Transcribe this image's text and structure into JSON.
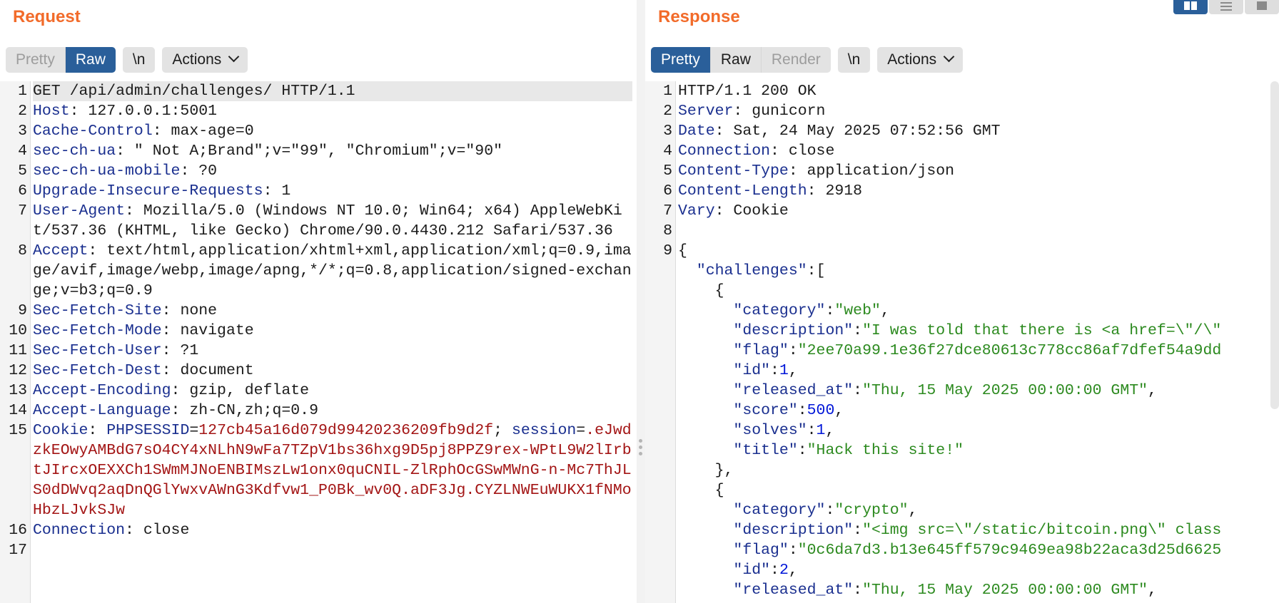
{
  "request": {
    "title": "Request",
    "tabs": [
      {
        "label": "Pretty",
        "state": "disabled"
      },
      {
        "label": "Raw",
        "state": "active"
      }
    ],
    "newline_label": "\\n",
    "actions_label": "Actions",
    "lines": [
      {
        "n": "1",
        "hl": true,
        "segs": [
          {
            "t": "GET /api/admin/challenges/ HTTP/1.1"
          }
        ]
      },
      {
        "n": "2",
        "segs": [
          {
            "c": "k",
            "t": "Host"
          },
          {
            "t": ": 127.0.0.1:5001"
          }
        ]
      },
      {
        "n": "3",
        "segs": [
          {
            "c": "k",
            "t": "Cache-Control"
          },
          {
            "t": ": max-age=0"
          }
        ]
      },
      {
        "n": "4",
        "segs": [
          {
            "c": "k",
            "t": "sec-ch-ua"
          },
          {
            "t": ": \" Not A;Brand\";v=\"99\", \"Chromium\";v=\"90\""
          }
        ]
      },
      {
        "n": "5",
        "segs": [
          {
            "c": "k",
            "t": "sec-ch-ua-mobile"
          },
          {
            "t": ": ?0"
          }
        ]
      },
      {
        "n": "6",
        "segs": [
          {
            "c": "k",
            "t": "Upgrade-Insecure-Requests"
          },
          {
            "t": ": 1"
          }
        ]
      },
      {
        "n": "7",
        "segs": [
          {
            "c": "k",
            "t": "User-Agent"
          },
          {
            "t": ": Mozilla/5.0 (Windows NT 10.0; Win64; x64) AppleWebKit/537.36 (KHTML, like Gecko) Chrome/90.0.4430.212 Safari/537.36"
          }
        ]
      },
      {
        "n": "8",
        "segs": [
          {
            "c": "k",
            "t": "Accept"
          },
          {
            "t": ": text/html,application/xhtml+xml,application/xml;q=0.9,image/avif,image/webp,image/apng,*/*;q=0.8,application/signed-exchange;v=b3;q=0.9"
          }
        ]
      },
      {
        "n": "9",
        "segs": [
          {
            "c": "k",
            "t": "Sec-Fetch-Site"
          },
          {
            "t": ": none"
          }
        ]
      },
      {
        "n": "10",
        "segs": [
          {
            "c": "k",
            "t": "Sec-Fetch-Mode"
          },
          {
            "t": ": navigate"
          }
        ]
      },
      {
        "n": "11",
        "segs": [
          {
            "c": "k",
            "t": "Sec-Fetch-User"
          },
          {
            "t": ": ?1"
          }
        ]
      },
      {
        "n": "12",
        "segs": [
          {
            "c": "k",
            "t": "Sec-Fetch-Dest"
          },
          {
            "t": ": document"
          }
        ]
      },
      {
        "n": "13",
        "segs": [
          {
            "c": "k",
            "t": "Accept-Encoding"
          },
          {
            "t": ": gzip, deflate"
          }
        ]
      },
      {
        "n": "14",
        "segs": [
          {
            "c": "k",
            "t": "Accept-Language"
          },
          {
            "t": ": zh-CN,zh;q=0.9"
          }
        ]
      },
      {
        "n": "15",
        "segs": [
          {
            "c": "k",
            "t": "Cookie"
          },
          {
            "t": ": "
          },
          {
            "c": "ck",
            "t": "PHPSESSID"
          },
          {
            "t": "="
          },
          {
            "c": "cv",
            "t": "127cb45a16d079d99420236209fb9d2f"
          },
          {
            "t": "; "
          },
          {
            "c": "ck",
            "t": "session"
          },
          {
            "t": "="
          },
          {
            "c": "cv",
            "t": ".eJwdzkEOwyAMBdG7sO4CY4xNLhN9wFa7TZpV1bs36hxg9D5pj8PPZ9rex-WPtL9W2lIrbtJIrcxOEXXCh1SWmMJNoENBIMszLw1onx0quCNIL-ZlRphOcGSwMWnG-n-Mc7ThJLS0dDWvq2aqDnQGlYwxvAWnG3Kdfvw1_P0Bk_wv0Q.aDF3Jg.CYZLNWEuWUKX1fNMoHbzLJvkSJw"
          }
        ]
      },
      {
        "n": "16",
        "segs": [
          {
            "c": "k",
            "t": "Connection"
          },
          {
            "t": ": close"
          }
        ]
      },
      {
        "n": "17",
        "segs": [
          {
            "t": ""
          }
        ]
      }
    ]
  },
  "response": {
    "title": "Response",
    "tabs": [
      {
        "label": "Pretty",
        "state": "active"
      },
      {
        "label": "Raw",
        "state": "normal"
      },
      {
        "label": "Render",
        "state": "disabled"
      }
    ],
    "newline_label": "\\n",
    "actions_label": "Actions",
    "lines": [
      {
        "n": "1",
        "segs": [
          {
            "t": "HTTP/1.1 200 OK"
          }
        ]
      },
      {
        "n": "2",
        "segs": [
          {
            "c": "k",
            "t": "Server"
          },
          {
            "t": ": gunicorn"
          }
        ]
      },
      {
        "n": "3",
        "segs": [
          {
            "c": "k",
            "t": "Date"
          },
          {
            "t": ": Sat, 24 May 2025 07:52:56 GMT"
          }
        ]
      },
      {
        "n": "4",
        "segs": [
          {
            "c": "k",
            "t": "Connection"
          },
          {
            "t": ": close"
          }
        ]
      },
      {
        "n": "5",
        "segs": [
          {
            "c": "k",
            "t": "Content-Type"
          },
          {
            "t": ": application/json"
          }
        ]
      },
      {
        "n": "6",
        "segs": [
          {
            "c": "k",
            "t": "Content-Length"
          },
          {
            "t": ": 2918"
          }
        ]
      },
      {
        "n": "7",
        "segs": [
          {
            "c": "k",
            "t": "Vary"
          },
          {
            "t": ": Cookie"
          }
        ]
      },
      {
        "n": "8",
        "segs": [
          {
            "t": ""
          }
        ]
      },
      {
        "n": "9",
        "segs": [
          {
            "t": "{"
          }
        ]
      },
      {
        "n": "",
        "segs": [
          {
            "t": "  "
          },
          {
            "c": "jk",
            "t": "\"challenges\""
          },
          {
            "t": ":["
          }
        ]
      },
      {
        "n": "",
        "segs": [
          {
            "t": "    {"
          }
        ]
      },
      {
        "n": "",
        "segs": [
          {
            "t": "      "
          },
          {
            "c": "jk",
            "t": "\"category\""
          },
          {
            "t": ":"
          },
          {
            "c": "js",
            "t": "\"web\""
          },
          {
            "t": ","
          }
        ]
      },
      {
        "n": "",
        "segs": [
          {
            "t": "      "
          },
          {
            "c": "jk",
            "t": "\"description\""
          },
          {
            "t": ":"
          },
          {
            "c": "js",
            "t": "\"I was told that there is <a href=\\\"/\\\""
          }
        ]
      },
      {
        "n": "",
        "segs": [
          {
            "t": "      "
          },
          {
            "c": "jk",
            "t": "\"flag\""
          },
          {
            "t": ":"
          },
          {
            "c": "js",
            "t": "\"2ee70a99.1e36f27dce80613c778cc86af7dfef54a9dd"
          }
        ]
      },
      {
        "n": "",
        "segs": [
          {
            "t": "      "
          },
          {
            "c": "jk",
            "t": "\"id\""
          },
          {
            "t": ":"
          },
          {
            "c": "jn",
            "t": "1"
          },
          {
            "t": ","
          }
        ]
      },
      {
        "n": "",
        "segs": [
          {
            "t": "      "
          },
          {
            "c": "jk",
            "t": "\"released_at\""
          },
          {
            "t": ":"
          },
          {
            "c": "js",
            "t": "\"Thu, 15 May 2025 00:00:00 GMT\""
          },
          {
            "t": ","
          }
        ]
      },
      {
        "n": "",
        "segs": [
          {
            "t": "      "
          },
          {
            "c": "jk",
            "t": "\"score\""
          },
          {
            "t": ":"
          },
          {
            "c": "jn",
            "t": "500"
          },
          {
            "t": ","
          }
        ]
      },
      {
        "n": "",
        "segs": [
          {
            "t": "      "
          },
          {
            "c": "jk",
            "t": "\"solves\""
          },
          {
            "t": ":"
          },
          {
            "c": "jn",
            "t": "1"
          },
          {
            "t": ","
          }
        ]
      },
      {
        "n": "",
        "segs": [
          {
            "t": "      "
          },
          {
            "c": "jk",
            "t": "\"title\""
          },
          {
            "t": ":"
          },
          {
            "c": "js",
            "t": "\"Hack this site!\""
          }
        ]
      },
      {
        "n": "",
        "segs": [
          {
            "t": "    },"
          }
        ]
      },
      {
        "n": "",
        "segs": [
          {
            "t": "    {"
          }
        ]
      },
      {
        "n": "",
        "segs": [
          {
            "t": "      "
          },
          {
            "c": "jk",
            "t": "\"category\""
          },
          {
            "t": ":"
          },
          {
            "c": "js",
            "t": "\"crypto\""
          },
          {
            "t": ","
          }
        ]
      },
      {
        "n": "",
        "segs": [
          {
            "t": "      "
          },
          {
            "c": "jk",
            "t": "\"description\""
          },
          {
            "t": ":"
          },
          {
            "c": "js",
            "t": "\"<img src=\\\"/static/bitcoin.png\\\" class"
          }
        ]
      },
      {
        "n": "",
        "segs": [
          {
            "t": "      "
          },
          {
            "c": "jk",
            "t": "\"flag\""
          },
          {
            "t": ":"
          },
          {
            "c": "js",
            "t": "\"0c6da7d3.b13e645ff579c9469ea98b22aca3d25d6625"
          }
        ]
      },
      {
        "n": "",
        "segs": [
          {
            "t": "      "
          },
          {
            "c": "jk",
            "t": "\"id\""
          },
          {
            "t": ":"
          },
          {
            "c": "jn",
            "t": "2"
          },
          {
            "t": ","
          }
        ]
      },
      {
        "n": "",
        "segs": [
          {
            "t": "      "
          },
          {
            "c": "jk",
            "t": "\"released_at\""
          },
          {
            "t": ":"
          },
          {
            "c": "js",
            "t": "\"Thu, 15 May 2025 00:00:00 GMT\""
          },
          {
            "t": ","
          }
        ]
      }
    ]
  },
  "layout_buttons": [
    {
      "icon": "split-columns-icon",
      "active": true
    },
    {
      "icon": "split-rows-icon",
      "active": false
    },
    {
      "icon": "single-pane-icon",
      "active": false
    }
  ]
}
